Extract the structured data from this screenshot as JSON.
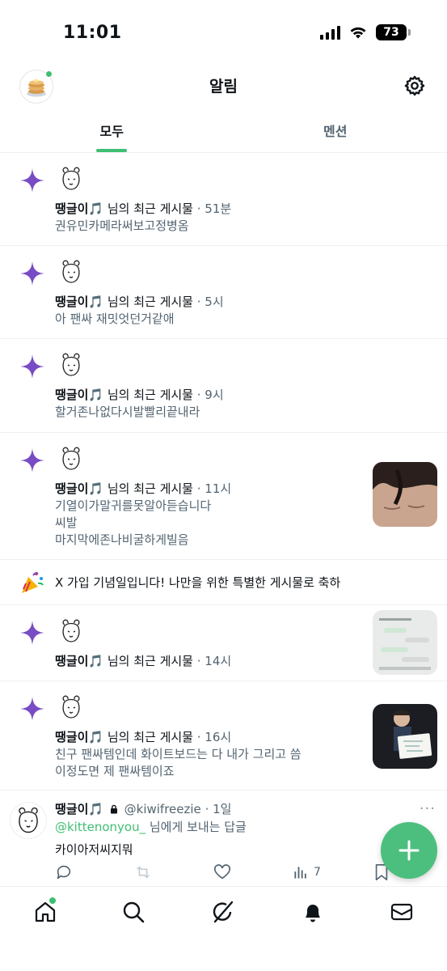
{
  "status_bar": {
    "time": "11:01",
    "battery": "73"
  },
  "header": {
    "title": "알림"
  },
  "tabs": [
    {
      "label": "모두",
      "active": true
    },
    {
      "label": "멘션",
      "active": false
    }
  ],
  "colors": {
    "accent": "#3fbf73",
    "sparkle": "#794bc4",
    "muted": "#536471"
  },
  "notifications": [
    {
      "name": "땡글이🎵",
      "action": " 님의 최근 게시물",
      "time": " · 51분",
      "preview": [
        "권유민카메라써보고정병옴"
      ],
      "has_thumb": false
    },
    {
      "name": "땡글이🎵",
      "action": " 님의 최근 게시물",
      "time": " · 5시",
      "preview": [
        "아 팬싸 재밋엇던거같애"
      ],
      "has_thumb": false
    },
    {
      "name": "땡글이🎵",
      "action": " 님의 최근 게시물",
      "time": " · 9시",
      "preview": [
        "할거존나없다시발빨리끝내라"
      ],
      "has_thumb": false
    },
    {
      "name": "땡글이🎵",
      "action": " 님의 최근 게시물",
      "time": " · 11시",
      "preview": [
        "기열이가말귀를못알아듣습니다",
        "씨발",
        "마지막에존나비굴하게빌음"
      ],
      "has_thumb": true
    },
    {
      "name": "땡글이🎵",
      "action": " 님의 최근 게시물",
      "time": " · 14시",
      "preview": [],
      "has_thumb": true
    },
    {
      "name": "땡글이🎵",
      "action": " 님의 최근 게시물",
      "time": " · 16시",
      "preview": [
        "친구 팬싸템인데 화이트보드는 다 내가 그리고 씀",
        "이정도면 제 팬싸템이죠"
      ],
      "has_thumb": true
    }
  ],
  "anniversary": {
    "text": "X 가입 기념일입니다! 나만을 위한 특별한 게시물로 축하"
  },
  "reply": {
    "name": "땡글이🎵",
    "handle": "@kiwifreezie",
    "time": "· 1일",
    "more": "···",
    "mention": "@kittenonyou_",
    "to_suffix": " 님에게 보내는 답글",
    "body": "카이아저씨지뭐",
    "views": "7"
  },
  "icons": {
    "settings": "gear-icon",
    "sparkle": "sparkle-icon",
    "party": "party-popper-icon",
    "compose": "plus-icon",
    "nav": [
      "home-icon",
      "search-icon",
      "grok-icon",
      "bell-icon",
      "mail-icon"
    ]
  }
}
